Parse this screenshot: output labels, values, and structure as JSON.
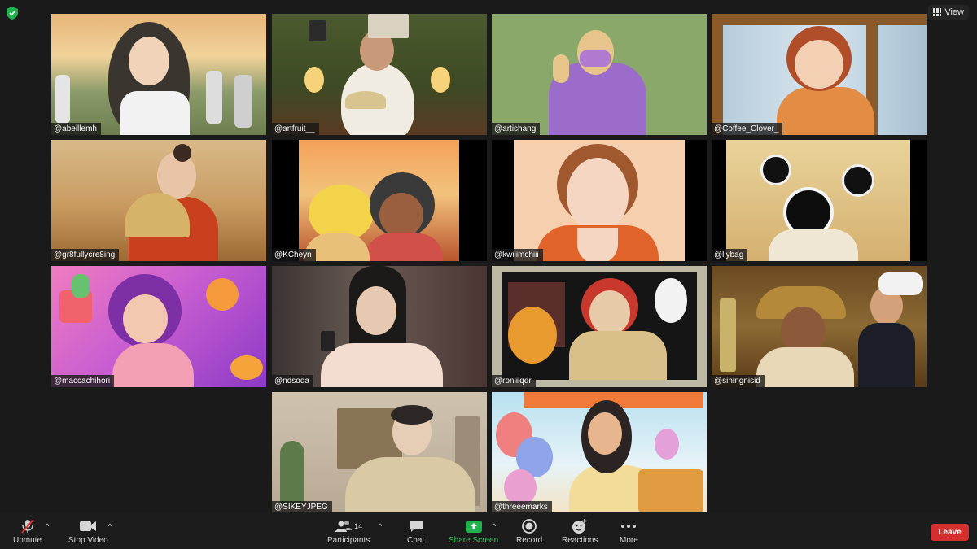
{
  "top": {
    "view_label": "View"
  },
  "tiles": [
    {
      "name": "@abeillemh"
    },
    {
      "name": "@artfruit__"
    },
    {
      "name": "@artishang"
    },
    {
      "name": "@Coffee_Clover_"
    },
    {
      "name": "@gr8fullycre8ing"
    },
    {
      "name": "@KCheyn"
    },
    {
      "name": "@kwiiimchiii"
    },
    {
      "name": "@llybag"
    },
    {
      "name": "@maccachihori"
    },
    {
      "name": "@ndsoda"
    },
    {
      "name": "@roniiiqdr"
    },
    {
      "name": "@siningnisid"
    },
    {
      "name": "@SIKEYJPEG"
    },
    {
      "name": "@threeemarks"
    }
  ],
  "toolbar": {
    "unmute": "Unmute",
    "stop_video": "Stop Video",
    "participants": "Participants",
    "participant_count": "14",
    "chat": "Chat",
    "share_screen": "Share Screen",
    "record": "Record",
    "reactions": "Reactions",
    "more": "More",
    "leave": "Leave"
  },
  "colors": {
    "background": "#1a1a1a",
    "share_green": "#22b14c",
    "leave_red": "#d32f2f",
    "mic_muted_red": "#e0312f"
  }
}
